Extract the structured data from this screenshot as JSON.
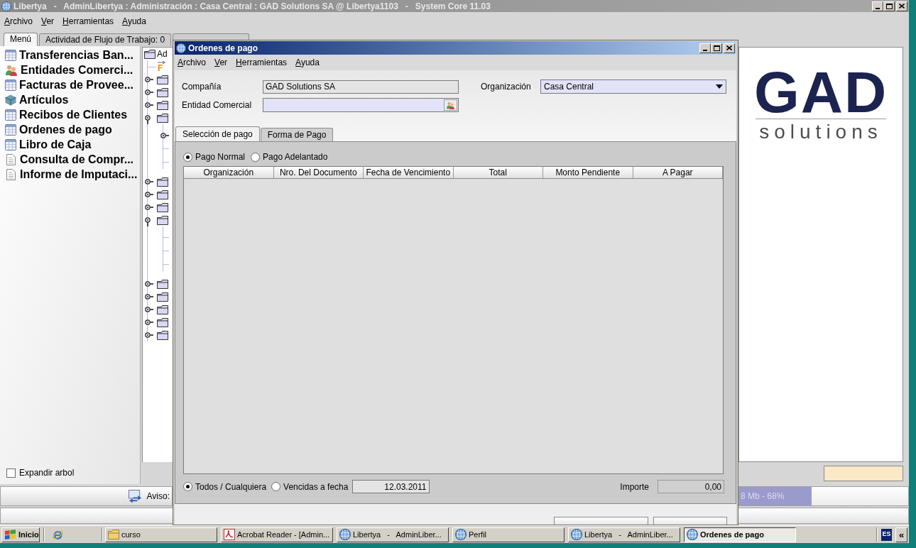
{
  "window": {
    "title": "Libertya   -   AdminLibertya : Administración : Casa Central : GAD Solutions SA @ Libertya1103   -   System Core 11.03"
  },
  "menu_bar": [
    "Archivo",
    "Ver",
    "Herramientas",
    "Ayuda"
  ],
  "tabs": [
    {
      "label": "Menú",
      "selected": true
    },
    {
      "label": "Actividad de Flujo de Trabajo: 0",
      "selected": false
    },
    {
      "selected": false
    }
  ],
  "menu_items": [
    {
      "label": "Transferencias Ban...",
      "kind": "window"
    },
    {
      "label": "Entidades Comerci...",
      "kind": "people"
    },
    {
      "label": "Facturas de Provee...",
      "kind": "window"
    },
    {
      "label": "Artículos",
      "kind": "product"
    },
    {
      "label": "Recibos de Clientes",
      "kind": "window"
    },
    {
      "label": "Ordenes de pago",
      "kind": "window"
    },
    {
      "label": "Libro de Caja",
      "kind": "window"
    },
    {
      "label": "Consulta de Compr...",
      "kind": "report"
    },
    {
      "label": "Informe de Imputaci...",
      "kind": "report"
    }
  ],
  "expand_tree": {
    "label": "Expandir arbol",
    "checked": false
  },
  "tree": [
    {
      "label": "Ad",
      "children": [
        {
          "kind": "process",
          "icon": "F"
        },
        {
          "kind": "folder",
          "expanded": false
        },
        {
          "kind": "folder",
          "expanded": false
        },
        {
          "kind": "folder",
          "expanded": false
        },
        {
          "kind": "folder",
          "expanded": true,
          "children": [
            {
              "kind": "folder",
              "expanded": false
            },
            {
              "kind": "item"
            },
            {
              "kind": "item"
            }
          ]
        },
        {
          "kind": "folder",
          "expanded": false
        },
        {
          "kind": "folder",
          "expanded": false
        },
        {
          "kind": "folder",
          "expanded": false
        },
        {
          "kind": "folder",
          "expanded": true,
          "children": [
            {
              "kind": "item"
            },
            {
              "kind": "item"
            },
            {
              "kind": "item"
            }
          ]
        },
        {
          "kind": "folder",
          "expanded": false
        },
        {
          "kind": "folder",
          "expanded": false
        },
        {
          "kind": "folder",
          "expanded": false
        },
        {
          "kind": "folder",
          "expanded": false
        },
        {
          "kind": "folder",
          "expanded": false
        }
      ]
    }
  ],
  "logo": {
    "mark": "GAD",
    "tagline": "solutions"
  },
  "status_bar": {
    "message": "Aviso:",
    "memory": {
      "reading": "8 Mb - 68%",
      "level": 0.43
    }
  },
  "dialog": {
    "title": "Ordenes de pago",
    "menu": [
      "Archivo",
      "Ver",
      "Herramientas",
      "Ayuda"
    ],
    "fields": [
      {
        "label": "Compañía",
        "kind": "text",
        "value": "GAD Solutions SA",
        "read_only": true
      },
      {
        "label": "Organización",
        "kind": "combo",
        "value": "Casa Central",
        "read_only": false
      },
      {
        "label": "Entidad Comercial",
        "kind": "lookup",
        "read_only": false
      }
    ],
    "tabs": [
      {
        "label": "Selección de pago",
        "selected": true
      },
      {
        "label": "Forma de Pago",
        "selected": false
      }
    ],
    "payment_type": [
      {
        "label": "Pago Normal",
        "selected": true
      },
      {
        "label": "Pago Adelantado",
        "selected": false
      }
    ],
    "table": {
      "columns": [
        "Organización",
        "Nro. Del Documento",
        "Fecha de Vencimiento",
        "Total",
        "Monto Pendiente",
        "A Pagar"
      ]
    },
    "due_filter": [
      {
        "label": "Todos / Cualquiera",
        "selected": true
      },
      {
        "label": "Vencidas a fecha",
        "selected": false
      }
    ],
    "due_date": "12.03.2011",
    "amount": {
      "label": "Importe",
      "value": "0,00"
    }
  },
  "taskbar": {
    "start": "Inicio",
    "items": [
      {
        "label": "curso",
        "kind": "folder",
        "selected": false
      },
      {
        "label": "Acrobat Reader - [Admin...",
        "kind": "pdf",
        "selected": false
      },
      {
        "label": "Libertya   -   AdminLiber...",
        "kind": "app",
        "selected": false
      },
      {
        "label": "Perfil",
        "kind": "app",
        "selected": false
      },
      {
        "label": "Libertya   -   AdminLiber...",
        "kind": "app",
        "selected": false
      },
      {
        "label": "Ordenes de pago",
        "kind": "app",
        "selected": true
      }
    ],
    "language": "ES",
    "tray_toggle": "«"
  }
}
